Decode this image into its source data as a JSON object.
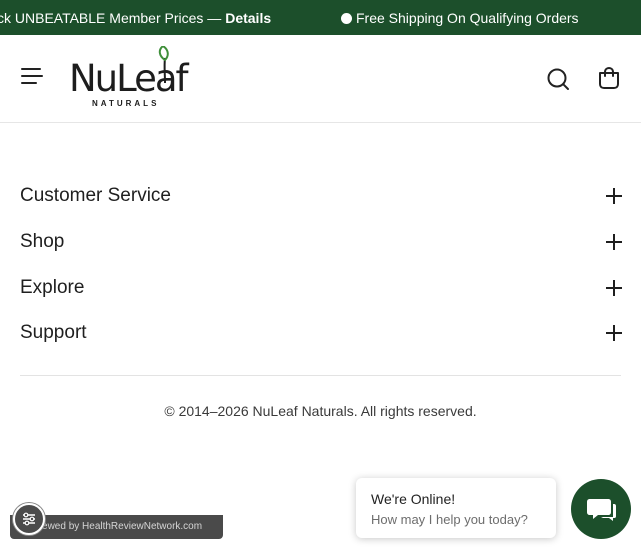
{
  "announcement": {
    "message1_text": "ck UNBEATABLE Member Prices — ",
    "message1_link": "Details",
    "message2_text": "Free Shipping On Qualifying Orders"
  },
  "header": {
    "logo_word": "NuLeaf",
    "logo_sub": "NATURALS",
    "icons": [
      "menu-icon",
      "search-icon",
      "cart-icon"
    ]
  },
  "footer": {
    "sections": [
      {
        "label": "Customer Service"
      },
      {
        "label": "Shop"
      },
      {
        "label": "Explore"
      },
      {
        "label": "Support"
      }
    ],
    "copyright": "© 2014–2026 NuLeaf Naturals. All rights reserved."
  },
  "widgets": {
    "reviewed_text": "Reviewed by HealthReviewNetwork.com",
    "chat_title": "We're Online!",
    "chat_subtitle": "How may I help you today?"
  },
  "colors": {
    "brand_green": "#1c4f2b",
    "leaf_green": "#3f8f3a",
    "text_dark": "#1f1f1f"
  }
}
